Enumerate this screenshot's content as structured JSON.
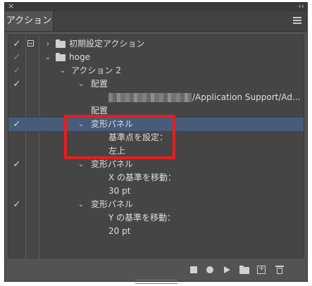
{
  "window": {
    "close_glyph": "×",
    "collapse_glyph": "‹‹",
    "tab_label": "アクション",
    "menu_icon": "panel-menu-icon"
  },
  "rows": [
    {
      "label": "初期設定アクション",
      "checked": true,
      "dim": false,
      "dialog": true,
      "chevron": "›",
      "folder": true
    },
    {
      "label": "hoge",
      "checked": true,
      "dim": true,
      "dialog": false,
      "chevron": "⌄",
      "folder": true
    },
    {
      "label": "アクション 2",
      "checked": true,
      "dim": true,
      "dialog": false,
      "chevron": "⌄",
      "folder": false
    },
    {
      "label": "配置",
      "checked": true,
      "dim": false,
      "dialog": false,
      "chevron": "⌄",
      "folder": false
    },
    {
      "label": "/Application Support/Ad...",
      "checked": false,
      "dim": false,
      "dialog": false,
      "chevron": "",
      "folder": false,
      "blurred": true
    },
    {
      "label": "配置",
      "checked": false,
      "dim": false,
      "dialog": false,
      "chevron": "",
      "folder": false
    },
    {
      "label": "変形パネル",
      "checked": true,
      "dim": false,
      "dialog": false,
      "chevron": "⌄",
      "folder": false,
      "selected": true
    },
    {
      "label": "基準点を設定：",
      "checked": false,
      "dim": false,
      "dialog": false,
      "chevron": "",
      "folder": false
    },
    {
      "label": "左上",
      "checked": false,
      "dim": false,
      "dialog": false,
      "chevron": "",
      "folder": false
    },
    {
      "label": "変形パネル",
      "checked": true,
      "dim": false,
      "dialog": false,
      "chevron": "⌄",
      "folder": false
    },
    {
      "label": "X の基準を移動：",
      "checked": false,
      "dim": false,
      "dialog": false,
      "chevron": "",
      "folder": false
    },
    {
      "label": "30 pt",
      "checked": false,
      "dim": false,
      "dialog": false,
      "chevron": "",
      "folder": false
    },
    {
      "label": "変形パネル",
      "checked": true,
      "dim": false,
      "dialog": false,
      "chevron": "⌄",
      "folder": false
    },
    {
      "label": "Y の基準を移動：",
      "checked": false,
      "dim": false,
      "dialog": false,
      "chevron": "",
      "folder": false
    },
    {
      "label": "20 pt",
      "checked": false,
      "dim": false,
      "dialog": false,
      "chevron": "",
      "folder": false
    }
  ],
  "check_glyph": "✓",
  "footer": {
    "buttons": [
      "stop-icon",
      "record-icon",
      "play-icon",
      "new-set-icon",
      "new-action-icon",
      "trash-icon"
    ]
  },
  "colors": {
    "panel": "#535353",
    "list_bg": "#454545",
    "selected_row": "#465c7a",
    "annotation_box": "#e81e1e"
  }
}
